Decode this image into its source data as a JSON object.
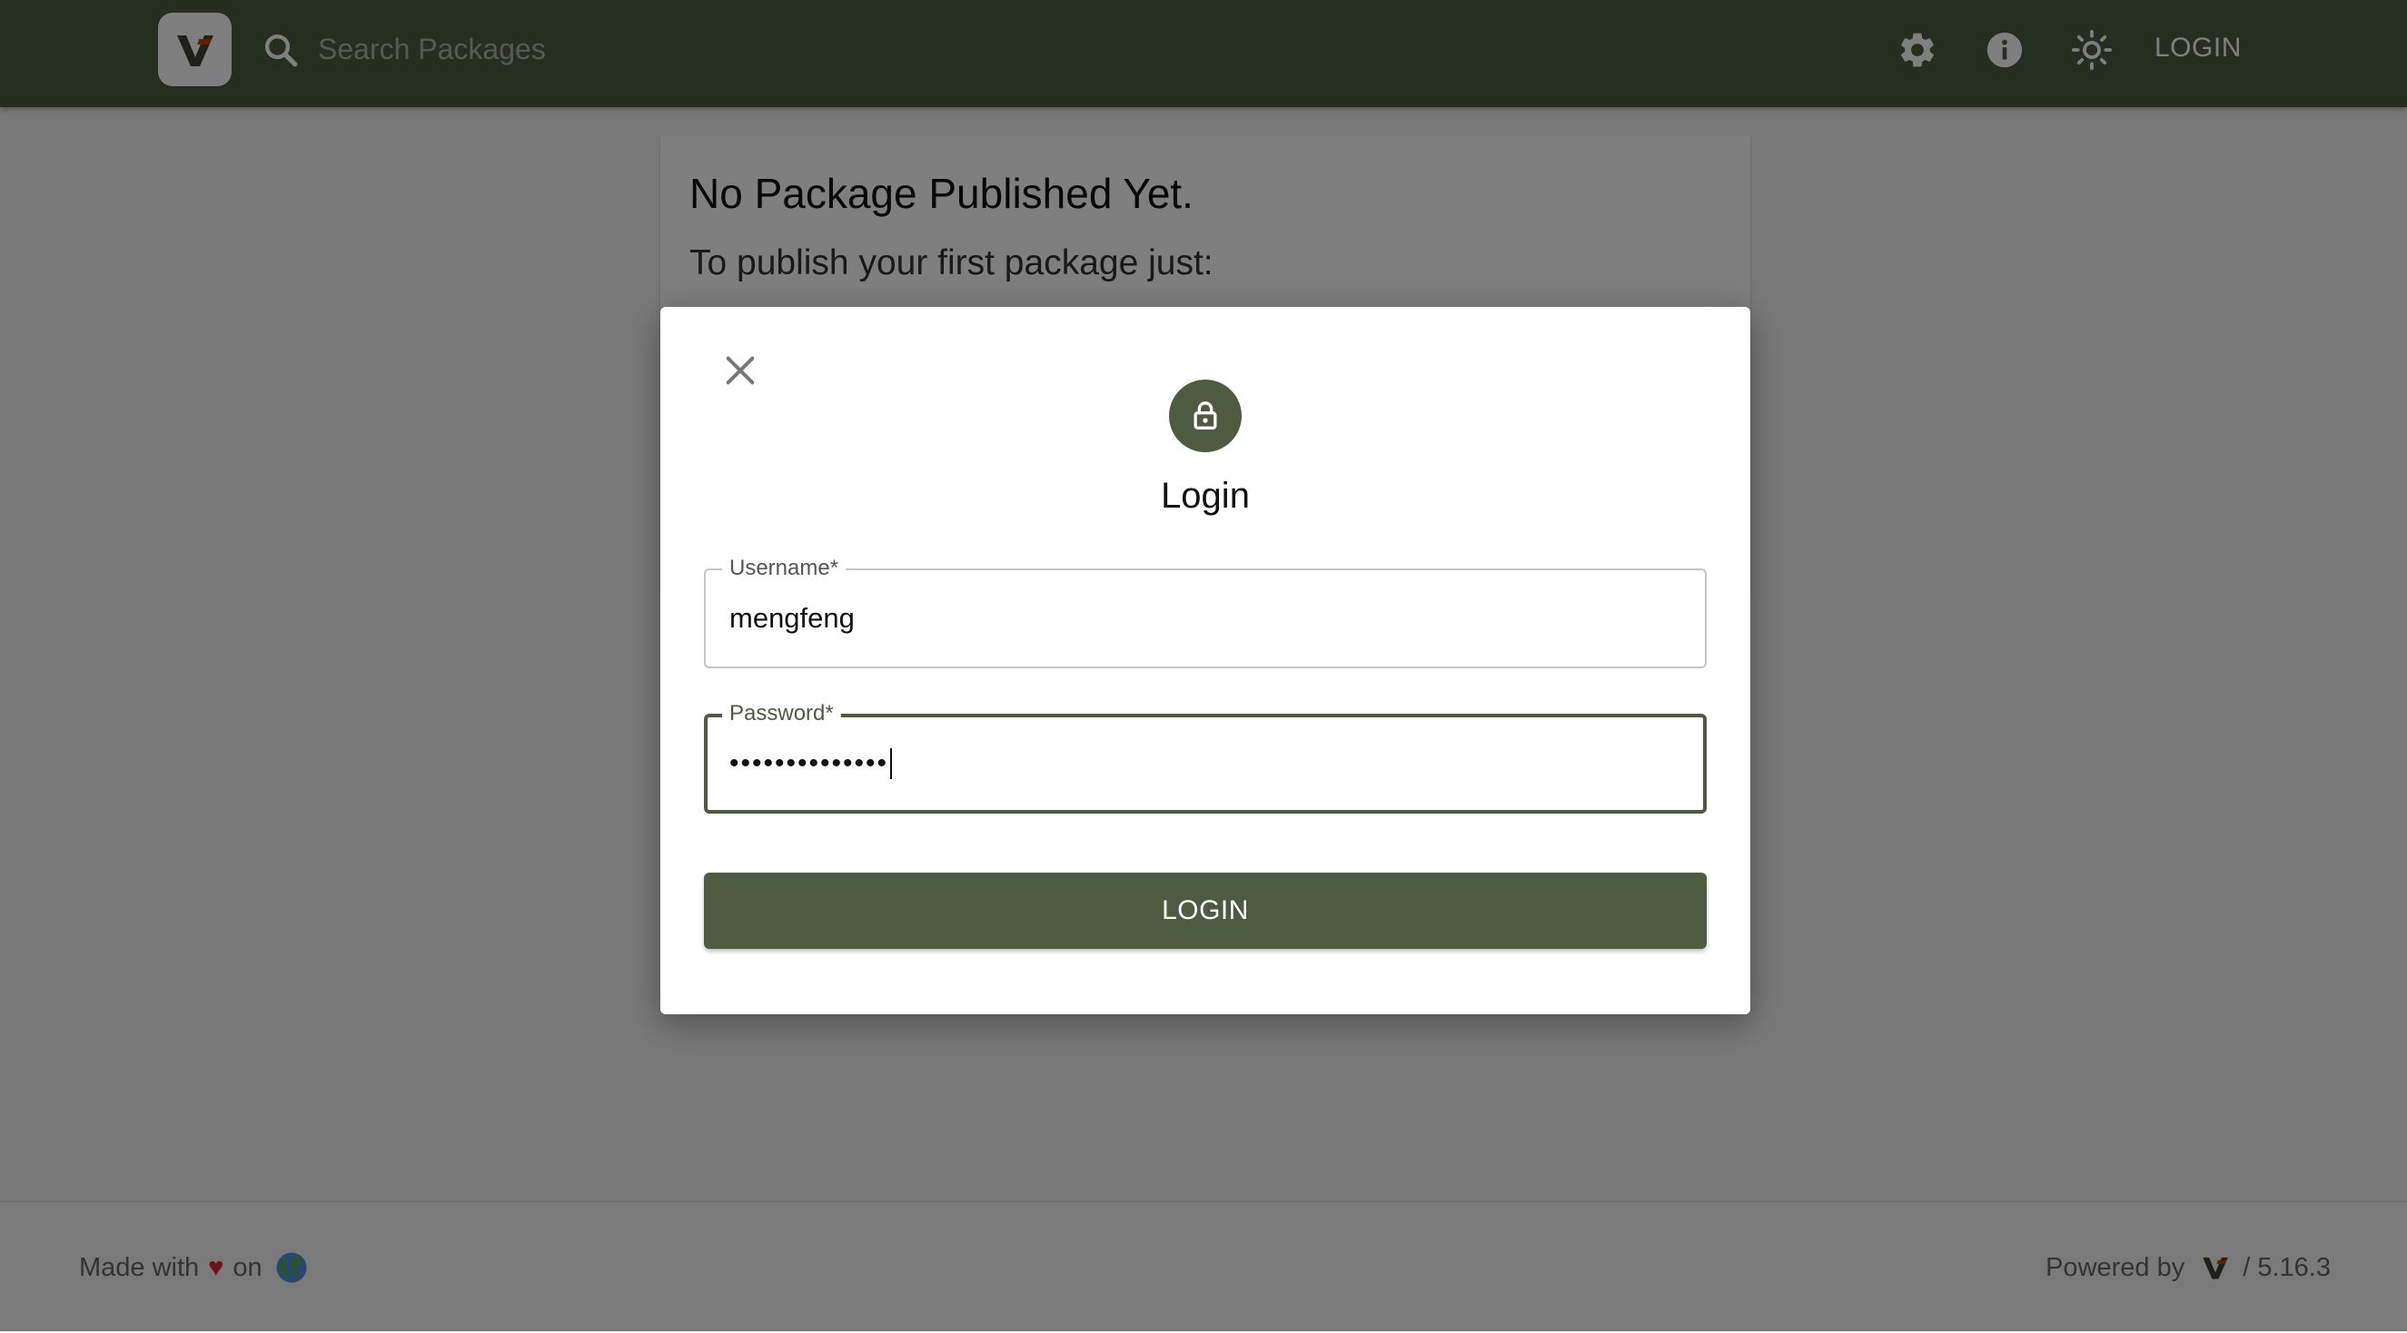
{
  "header": {
    "logo_icon": "verdaccio-logo-icon",
    "search": {
      "placeholder": "Search Packages",
      "value": ""
    },
    "icons": [
      "settings-gear-icon",
      "info-icon",
      "theme-sun-icon"
    ],
    "login_label": "LOGIN"
  },
  "main": {
    "title": "No Package Published Yet.",
    "subtitle": "To publish your first package just:"
  },
  "dialog": {
    "title": "Login",
    "close_icon": "close-icon",
    "lock_icon": "lock-icon",
    "username": {
      "label": "Username*",
      "value": "mengfeng"
    },
    "password": {
      "label": "Password*",
      "masked_value": "••••••••••••••"
    },
    "submit_label": "LOGIN"
  },
  "footer": {
    "made_with": "Made with",
    "heart": "♥",
    "on": "on",
    "globe_icon": "globe-icon",
    "powered_by": "Powered by",
    "version": "/ 5.16.3"
  },
  "colors": {
    "brand": "#4d5c41",
    "heart": "#e0222c",
    "logo_accent": "#cd4000"
  }
}
